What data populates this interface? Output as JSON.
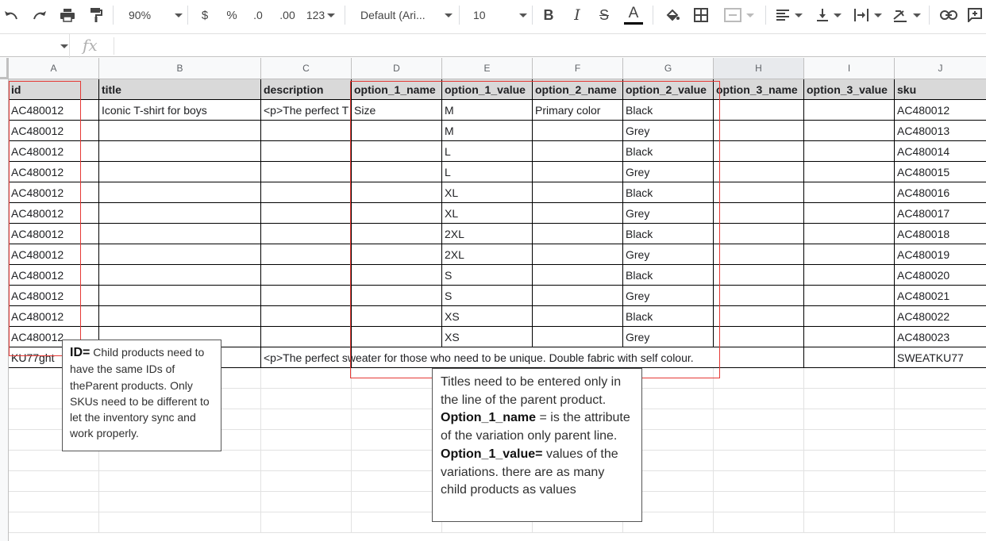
{
  "toolbar": {
    "zoom": "90%",
    "currency": "$",
    "percent": "%",
    "decrease_decimals": ".0",
    "increase_decimals": ".00",
    "more_formats": "123",
    "font": "Default (Ari...",
    "font_size": "10",
    "bold": "B",
    "italic": "I",
    "strikethrough": "S",
    "text_color": "A"
  },
  "formula_bar": {
    "fx": "fx"
  },
  "columns": [
    "A",
    "B",
    "C",
    "D",
    "E",
    "F",
    "G",
    "H",
    "I",
    "J"
  ],
  "header_row": [
    "id",
    "title",
    "description",
    "option_1_name",
    "option_1_value",
    "option_2_name",
    "option_2_value",
    "option_3_name",
    "option_3_value",
    "sku"
  ],
  "rows": [
    [
      "AC480012",
      "Iconic T-shirt for boys",
      "<p>The perfect T",
      "Size",
      "M",
      "Primary color",
      "Black",
      "",
      "",
      "AC480012"
    ],
    [
      "AC480012",
      "",
      "",
      "",
      "M",
      "",
      "Grey",
      "",
      "",
      "AC480013"
    ],
    [
      "AC480012",
      "",
      "",
      "",
      "L",
      "",
      "Black",
      "",
      "",
      "AC480014"
    ],
    [
      "AC480012",
      "",
      "",
      "",
      "L",
      "",
      "Grey",
      "",
      "",
      "AC480015"
    ],
    [
      "AC480012",
      "",
      "",
      "",
      "XL",
      "",
      "Black",
      "",
      "",
      "AC480016"
    ],
    [
      "AC480012",
      "",
      "",
      "",
      "XL",
      "",
      "Grey",
      "",
      "",
      "AC480017"
    ],
    [
      "AC480012",
      "",
      "",
      "",
      "2XL",
      "",
      "Black",
      "",
      "",
      "AC480018"
    ],
    [
      "AC480012",
      "",
      "",
      "",
      "2XL",
      "",
      "Grey",
      "",
      "",
      "AC480019"
    ],
    [
      "AC480012",
      "",
      "",
      "",
      "S",
      "",
      "Black",
      "",
      "",
      "AC480020"
    ],
    [
      "AC480012",
      "",
      "",
      "",
      "S",
      "",
      "Grey",
      "",
      "",
      "AC480021"
    ],
    [
      "AC480012",
      "",
      "",
      "",
      "XS",
      "",
      "Black",
      "",
      "",
      "AC480022"
    ],
    [
      "AC480012",
      "",
      "",
      "",
      "XS",
      "",
      "Grey",
      "",
      "",
      "AC480023"
    ],
    [
      "KU77ght",
      "",
      "<p>The perfect sweater for those who need to be unique. Double fabric with self colour.",
      "",
      "",
      "",
      "",
      "",
      "",
      "SWEATKU77"
    ]
  ],
  "notes": {
    "id_note": {
      "label": "ID=",
      "text": " Child products need to have the same IDs of theParent products. Only SKUs need to be different to let the inventory sync and work properly."
    },
    "options_note": {
      "intro": "Titles need to be entered only in the line of the parent product.",
      "opt1_name_label": "Option_1_name",
      "opt1_name_text": " = is the attribute of the variation only parent line.",
      "opt1_value_label": "Option_1_value=",
      "opt1_value_text": " values of the variations. there are as many child products as values"
    }
  },
  "colors": {
    "accent_red": "#e53935",
    "header_fill": "#d9d9d9"
  }
}
